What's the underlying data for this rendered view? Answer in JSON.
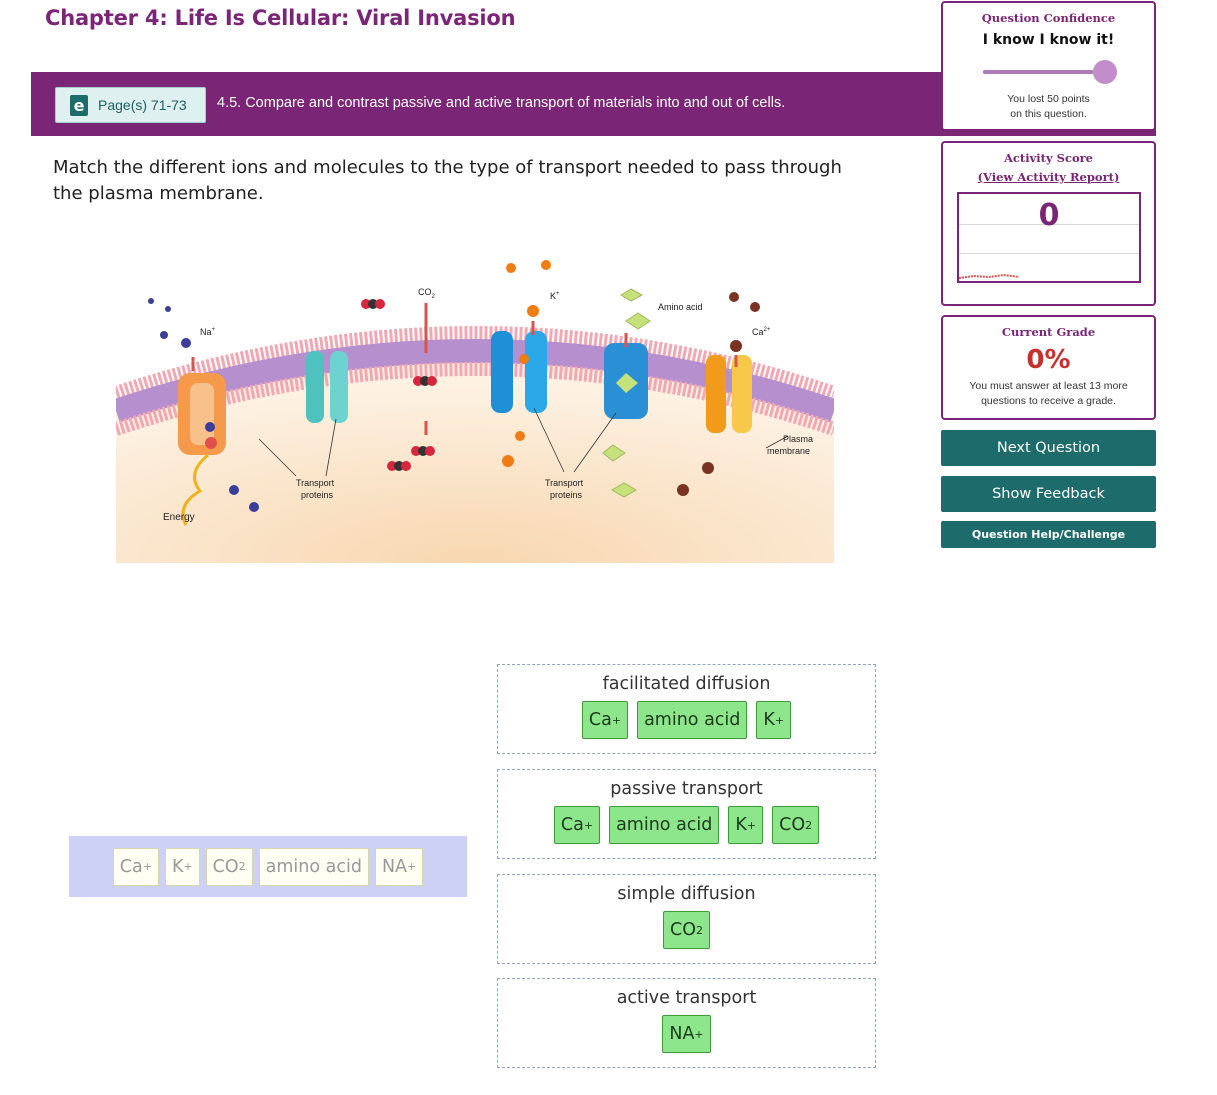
{
  "chapter_title": "Chapter 4: Life Is Cellular: Viral Invasion",
  "banner": {
    "page_ref_icon": "e",
    "page_ref_label": "Page(s) 71-73",
    "objective": "4.5. Compare and contrast passive and active transport of materials into and out of cells."
  },
  "question_text": "Match the different ions and molecules to the type of transport needed to pass through the plasma membrane.",
  "figure": {
    "labels": {
      "na": "Na",
      "co2": "CO",
      "k": "K",
      "amino_acid": "Amino acid",
      "ca": "Ca",
      "plasma_membrane_1": "Plasma",
      "plasma_membrane_2": "membrane",
      "transport_proteins_1": "Transport",
      "transport_proteins_2": "proteins",
      "energy": "Energy"
    },
    "colors": {
      "membrane_head": "#f2a7b3",
      "membrane_tail": "#b68fcf",
      "cytoplasm": "#fbe6cc",
      "extracellular": "#ffffff",
      "na_ion": "#3b3d9b",
      "k_ion": "#f07c14",
      "ca_ion": "#7a3222",
      "amino_acid": "#c6e07a",
      "co2_carbon": "#333333",
      "co2_oxygen": "#d7263d"
    }
  },
  "confidence": {
    "title": "Question Confidence",
    "value": "I know I know it!",
    "level": 1.0,
    "note_line1": "You lost 50 points",
    "note_line2": "on this question."
  },
  "activity_score": {
    "title": "Activity Score",
    "link": "(View Activity Report)",
    "value": "0"
  },
  "current_grade": {
    "title": "Current Grade",
    "value": "0%",
    "note_line1": "You must answer at least 13 more",
    "note_line2": "questions to receive a grade."
  },
  "buttons": {
    "next": "Next Question",
    "feedback": "Show Feedback",
    "help": "Question Help/Challenge"
  },
  "bank_items": [
    {
      "base": "Ca",
      "sup": "+",
      "sub": ""
    },
    {
      "base": "K",
      "sup": "+",
      "sub": ""
    },
    {
      "base": "CO",
      "sup": "",
      "sub": "2"
    },
    {
      "base": "amino acid",
      "sup": "",
      "sub": ""
    },
    {
      "base": "NA",
      "sup": "+",
      "sub": ""
    }
  ],
  "zones": [
    {
      "title": "facilitated diffusion",
      "chips": [
        {
          "base": "Ca",
          "sup": "+",
          "sub": ""
        },
        {
          "base": "amino acid",
          "sup": "",
          "sub": ""
        },
        {
          "base": "K",
          "sup": "+",
          "sub": ""
        }
      ]
    },
    {
      "title": "passive transport",
      "chips": [
        {
          "base": "Ca",
          "sup": "+",
          "sub": ""
        },
        {
          "base": "amino acid",
          "sup": "",
          "sub": ""
        },
        {
          "base": "K",
          "sup": "+",
          "sub": ""
        },
        {
          "base": "CO",
          "sup": "",
          "sub": "2"
        }
      ]
    },
    {
      "title": "simple diffusion",
      "chips": [
        {
          "base": "CO",
          "sup": "",
          "sub": "2"
        }
      ]
    },
    {
      "title": "active transport",
      "chips": [
        {
          "base": "NA",
          "sup": "+",
          "sub": ""
        }
      ]
    }
  ]
}
